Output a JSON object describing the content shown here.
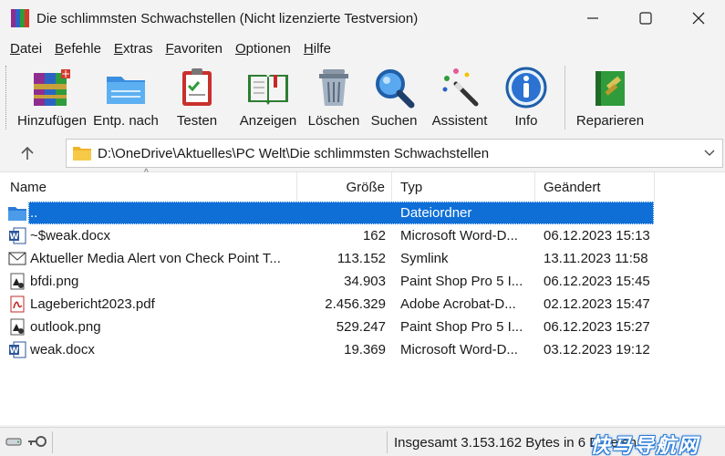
{
  "window": {
    "title": "Die schlimmsten Schwachstellen (Nicht lizenzierte Testversion)"
  },
  "menu": [
    {
      "label": "Datei",
      "ul": "D",
      "rest": "atei"
    },
    {
      "label": "Befehle",
      "ul": "B",
      "rest": "efehle"
    },
    {
      "label": "Extras",
      "ul": "E",
      "rest": "xtras"
    },
    {
      "label": "Favoriten",
      "ul": "F",
      "rest": "avoriten"
    },
    {
      "label": "Optionen",
      "ul": "O",
      "rest": "ptionen"
    },
    {
      "label": "Hilfe",
      "ul": "H",
      "rest": "ilfe"
    }
  ],
  "toolbar": {
    "add": "Hinzufügen",
    "extract": "Entp. nach",
    "test": "Testen",
    "view": "Anzeigen",
    "delete": "Löschen",
    "find": "Suchen",
    "wizard": "Assistent",
    "info": "Info",
    "repair": "Reparieren"
  },
  "address": {
    "path": "D:\\OneDrive\\Aktuelles\\PC Welt\\Die schlimmsten Schwachstellen"
  },
  "columns": {
    "name": "Name",
    "size": "Größe",
    "type": "Typ",
    "modified": "Geändert"
  },
  "files": [
    {
      "name": "..",
      "size": "",
      "type": "Dateiordner",
      "modified": "",
      "icon": "folder-icon"
    },
    {
      "name": "~$weak.docx",
      "size": "162",
      "type": "Microsoft Word-D...",
      "modified": "06.12.2023 15:13",
      "icon": "word-doc-icon"
    },
    {
      "name": "Aktueller Media Alert von Check Point T...",
      "size": "113.152",
      "type": "Symlink",
      "modified": "13.11.2023 11:58",
      "icon": "mail-icon"
    },
    {
      "name": "bfdi.png",
      "size": "34.903",
      "type": "Paint Shop Pro 5 I...",
      "modified": "06.12.2023 15:45",
      "icon": "image-file-icon"
    },
    {
      "name": "Lagebericht2023.pdf",
      "size": "2.456.329",
      "type": "Adobe Acrobat-D...",
      "modified": "02.12.2023 15:47",
      "icon": "pdf-icon"
    },
    {
      "name": "outlook.png",
      "size": "529.247",
      "type": "Paint Shop Pro 5 I...",
      "modified": "06.12.2023 15:27",
      "icon": "image-file-icon"
    },
    {
      "name": "weak.docx",
      "size": "19.369",
      "type": "Microsoft Word-D...",
      "modified": "03.12.2023 19:12",
      "icon": "word-doc-icon"
    }
  ],
  "status": {
    "text": "Insgesamt 3.153.162 Bytes in 6 Dateien"
  },
  "watermark": "快马导航网",
  "colors": {
    "selection": "#0f6fd7",
    "watermark": "#2a7bd6"
  }
}
